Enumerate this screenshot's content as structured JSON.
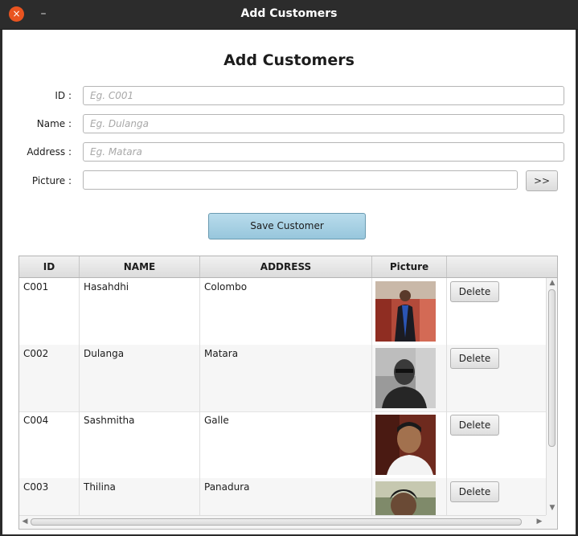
{
  "window": {
    "title": "Add Customers",
    "close_icon": "×",
    "minimize_icon": "–"
  },
  "form": {
    "title": "Add Customers",
    "fields": {
      "id": {
        "label": "ID :",
        "placeholder": "Eg. C001",
        "value": ""
      },
      "name": {
        "label": "Name :",
        "placeholder": "Eg. Dulanga",
        "value": ""
      },
      "address": {
        "label": "Address :",
        "placeholder": "Eg. Matara",
        "value": ""
      },
      "picture": {
        "label": "Picture :",
        "placeholder": "",
        "value": ""
      }
    },
    "browse_label": ">>",
    "save_label": "Save Customer"
  },
  "table": {
    "columns": [
      "ID",
      "NAME",
      "ADDRESS",
      "Picture",
      ""
    ],
    "rows": [
      {
        "id": "C001",
        "name": "Hasahdhi",
        "address": "Colombo",
        "delete_label": "Delete"
      },
      {
        "id": "C002",
        "name": "Dulanga",
        "address": "Matara",
        "delete_label": "Delete"
      },
      {
        "id": "C004",
        "name": "Sashmitha",
        "address": "Galle",
        "delete_label": "Delete"
      },
      {
        "id": "C003",
        "name": "Thilina",
        "address": "Panadura",
        "delete_label": "Delete"
      }
    ]
  },
  "colors": {
    "accent": "#e95420",
    "save_button": "#a9d3e6",
    "titlebar": "#2c2c2c"
  }
}
